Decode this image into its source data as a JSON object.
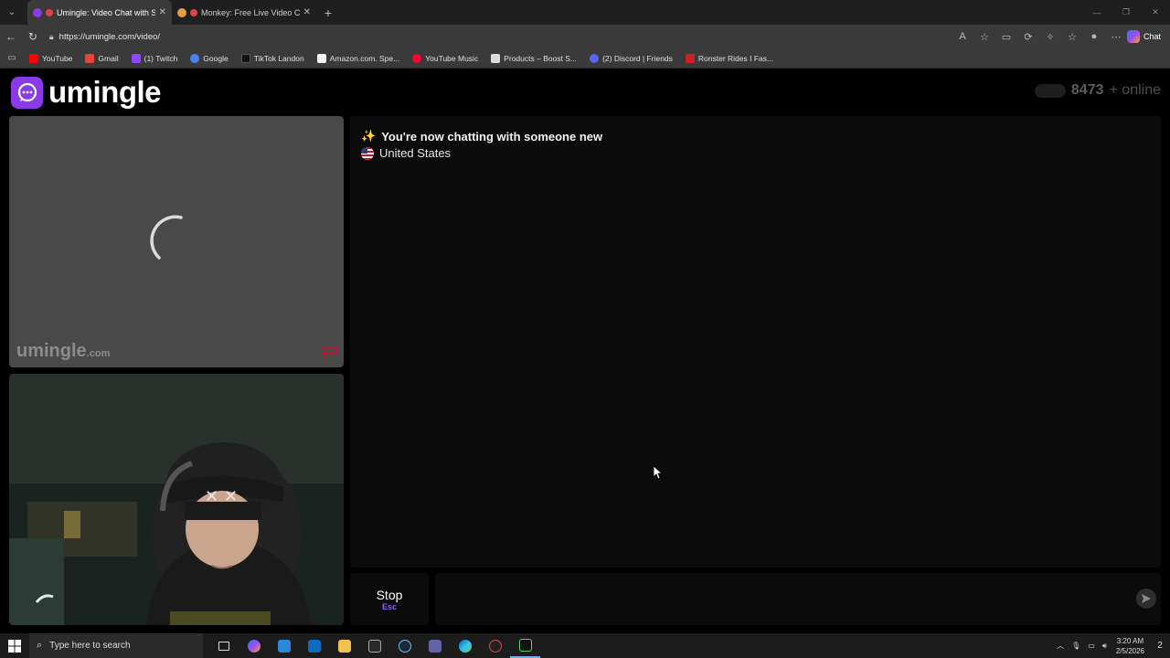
{
  "browser": {
    "tabs": [
      {
        "title": "Umingle: Video Chat with Stra",
        "color": "#8a3ae6",
        "active": true
      },
      {
        "title": "Monkey: Free Live Video Chat",
        "color": "#e0a040",
        "active": false
      }
    ],
    "url": "https://umingle.com/video/",
    "chat_button": "Chat",
    "bookmarks": [
      {
        "label": "YouTube",
        "color": "#ff0000"
      },
      {
        "label": "Gmail",
        "color": "#ea4335"
      },
      {
        "label": "(1) Twitch",
        "color": "#9146ff"
      },
      {
        "label": "Google",
        "color": "#4285f4"
      },
      {
        "label": "TikTok Landon",
        "color": "#111111"
      },
      {
        "label": "Amazon.com. Spe...",
        "color": "#f3f3f3"
      },
      {
        "label": "YouTube Music",
        "color": "#ff0033"
      },
      {
        "label": "Products – Boost S...",
        "color": "#dddddd"
      },
      {
        "label": "(2) Discord | Friends",
        "color": "#5865f2"
      },
      {
        "label": "Ronster Rides I Fas...",
        "color": "#cc2222"
      }
    ]
  },
  "page": {
    "brand": "umingle",
    "online_count": "8473",
    "online_suffix": "+ online",
    "watermark": "umingle",
    "watermark_suffix": ".com",
    "chat": {
      "status_message": "You're now chatting with someone new",
      "status_icon": "sparkles-icon",
      "location": "United States"
    },
    "stop_button": {
      "label": "Stop",
      "shortcut": "Esc"
    },
    "accent_color": "#8a3ae6"
  },
  "taskbar": {
    "search_placeholder": "Type here to search",
    "time": "3:20 AM",
    "date": "2/5/2026",
    "notification_count": "2"
  }
}
